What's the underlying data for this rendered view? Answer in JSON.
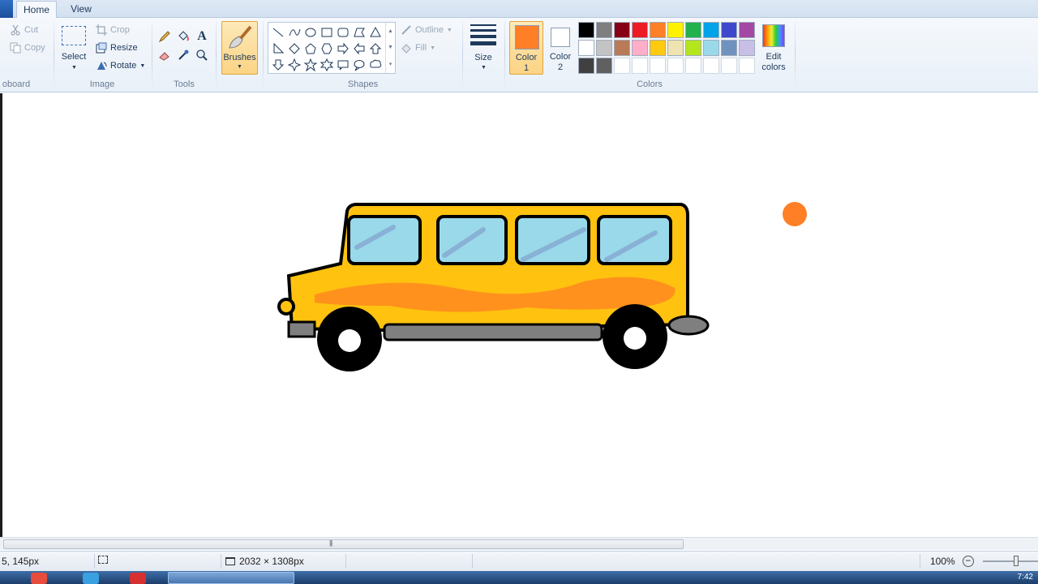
{
  "tabs": [
    {
      "label": "Home",
      "active": true
    },
    {
      "label": "View",
      "active": false
    }
  ],
  "clipboard": {
    "cut": "Cut",
    "copy": "Copy",
    "group": "oboard"
  },
  "image": {
    "select": "Select",
    "crop": "Crop",
    "resize": "Resize",
    "rotate": "Rotate",
    "group": "Image"
  },
  "tools": {
    "group": "Tools",
    "icons": [
      "pencil-icon",
      "fill-bucket-icon",
      "text-icon",
      "eraser-icon",
      "color-picker-icon",
      "magnifier-icon"
    ]
  },
  "brushes": {
    "label": "Brushes"
  },
  "shapes": {
    "outline": "Outline",
    "fill": "Fill",
    "group": "Shapes"
  },
  "size": {
    "label": "Size"
  },
  "colors": {
    "color1_label": "Color",
    "color1_num": "1",
    "color2_label": "Color",
    "color2_num": "2",
    "color1_value": "#ff7f27",
    "color2_value": "#ffffff",
    "edit": "Edit",
    "edit2": "colors",
    "group": "Colors",
    "palette": [
      "#000000",
      "#7f7f7f",
      "#880015",
      "#ed1c24",
      "#ff7f27",
      "#fff200",
      "#22b14c",
      "#00a2e8",
      "#3f48cc",
      "#a349a4",
      "#ffffff",
      "#c3c3c3",
      "#b97a57",
      "#ffaec9",
      "#ffc90e",
      "#efe4b0",
      "#b5e61d",
      "#99d9ea",
      "#7092be",
      "#c8bfe7",
      "#404040",
      "#606060",
      "",
      "",
      "",
      "",
      "",
      "",
      "",
      ""
    ]
  },
  "status": {
    "cursor_pos": "5, 145px",
    "image_size": "2032 × 1308px",
    "zoom": "100%"
  },
  "taskbar": {
    "time": "7:42"
  }
}
